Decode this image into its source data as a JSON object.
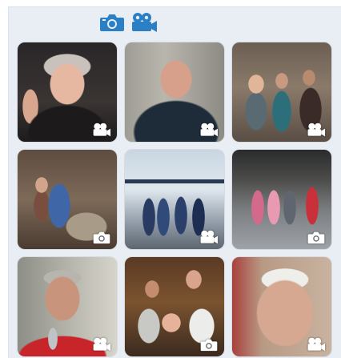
{
  "filters": [
    {
      "name": "camera-filter",
      "icon": "camera-icon",
      "color": "#2b7fc4"
    },
    {
      "name": "video-filter",
      "icon": "video-camera-icon",
      "color": "#2b7fc4"
    }
  ],
  "grid": {
    "tiles": [
      {
        "thumb": "t1",
        "media_icon": "video-camera-icon"
      },
      {
        "thumb": "t2",
        "media_icon": "video-camera-icon"
      },
      {
        "thumb": "t3",
        "media_icon": "video-camera-icon"
      },
      {
        "thumb": "t4",
        "media_icon": "camera-icon"
      },
      {
        "thumb": "t5",
        "media_icon": "video-camera-icon"
      },
      {
        "thumb": "t6",
        "media_icon": "camera-icon"
      },
      {
        "thumb": "t7",
        "media_icon": "video-camera-icon"
      },
      {
        "thumb": "t8",
        "media_icon": "camera-icon"
      },
      {
        "thumb": "t9",
        "media_icon": "video-camera-icon"
      }
    ]
  },
  "colors": {
    "panel_bg": "#e8eef4",
    "accent": "#2b7fc4",
    "badge": "#ffffff"
  }
}
